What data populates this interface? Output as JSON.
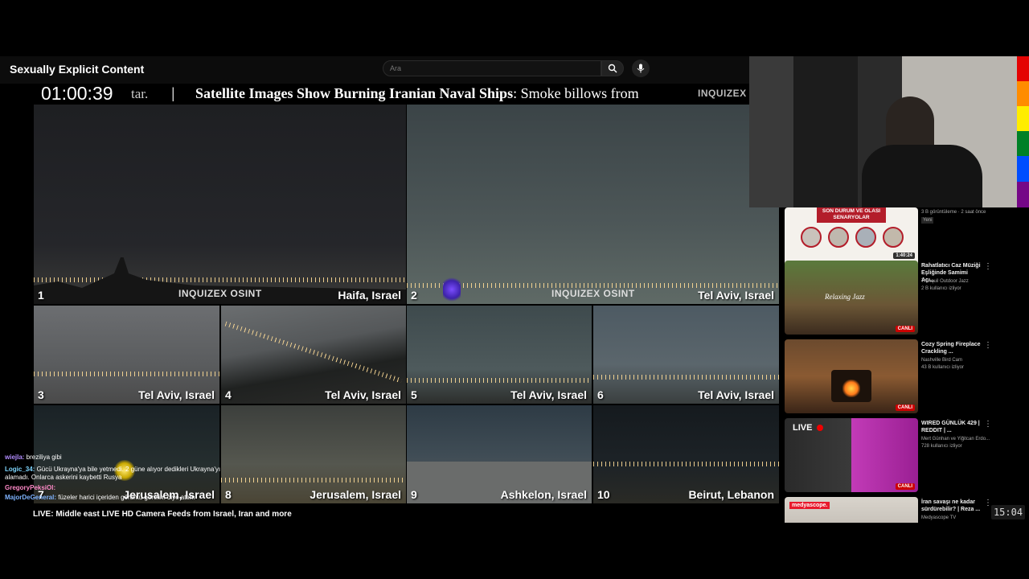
{
  "header": {
    "title": "Sexually Explicit Content",
    "search_placeholder": "Ara"
  },
  "ticker": {
    "clock": "01:00:39",
    "fragment": "tar.",
    "separator": "|",
    "headline_bold": "Satellite Images Show Burning Iranian Naval Ships",
    "headline_rest": ": Smoke billows from",
    "logo": "INQUIZEX"
  },
  "cameras": [
    {
      "number": "1",
      "label": "Haifa, Israel",
      "watermark": "INQUIZEX OSINT"
    },
    {
      "number": "2",
      "label": "Tel Aviv, Israel",
      "watermark": "INQUIZEX OSINT"
    },
    {
      "number": "3",
      "label": "Tel Aviv, Israel"
    },
    {
      "number": "4",
      "label": "Tel Aviv, Israel"
    },
    {
      "number": "5",
      "label": "Tel Aviv, Israel"
    },
    {
      "number": "6",
      "label": "Tel Aviv, Israel"
    },
    {
      "number": "7",
      "label": "Jerusalem, Israel"
    },
    {
      "number": "8",
      "label": "Jerusalem, Israel"
    },
    {
      "number": "9",
      "label": "Ashkelon, Israel"
    },
    {
      "number": "10",
      "label": "Beirut, Lebanon"
    }
  ],
  "chat": [
    {
      "user": "wiejla:",
      "text": " breziliya gibi"
    },
    {
      "user": "Logic_34:",
      "text": " Gücü Ukrayna'ya bile yetmedi. 2 güne alıyor dedikleri Ukrayna'yı alamadı. Onlarca askerini kaybetti Rusya"
    },
    {
      "user": "GregoryPeksiOl:",
      "text": ""
    },
    {
      "user": "MajorDeGeneral:",
      "text": " füzeler harici içeriden görüntü görelim diye attım"
    }
  ],
  "stream_title": "LIVE: Middle east LIVE HD Camera Feeds from Israel, Iran and more",
  "sidebar": {
    "top_meta": "3 B görüntüleme · 2 saat önce",
    "top_badge": "Yeni",
    "videos": [
      {
        "thumb_title": "SON DURUM VE OLASI SENARYOLAR",
        "badge": "1:40:24"
      },
      {
        "title": "Rahatlatıcı Caz Müziği Eşliğinde Samimi Açı...",
        "channel": "Tranquil Outdoor Jazz",
        "meta": "2 B kullanıcı izliyor",
        "badge": "CANLI",
        "thumb_text": "Relaxing Jazz"
      },
      {
        "title": "Cozy Spring Fireplace Crackling ...",
        "channel": "Nashville Bird Cam",
        "meta": "43 B kullanıcı izliyor",
        "badge": "CANLI"
      },
      {
        "title": "WIRED GÜNLÜK 429 | REDDIT | ...",
        "channel": "Mert Günhan ve Yiğitcan Erdo...",
        "meta": "728 kullanıcı izliyor",
        "badge": "CANLI",
        "thumb_text": "LIVE"
      },
      {
        "title": "İran savaşı ne kadar sürdürebilir? | Reza ...",
        "channel": "Medyascope TV",
        "thumb_text": "medyascope."
      }
    ]
  },
  "clock_badge": "15:04",
  "colors": {
    "live_red": "#cc0000",
    "rainbow": [
      "#e40303",
      "#ff8c00",
      "#ffed00",
      "#008026",
      "#004dff",
      "#750787"
    ]
  }
}
